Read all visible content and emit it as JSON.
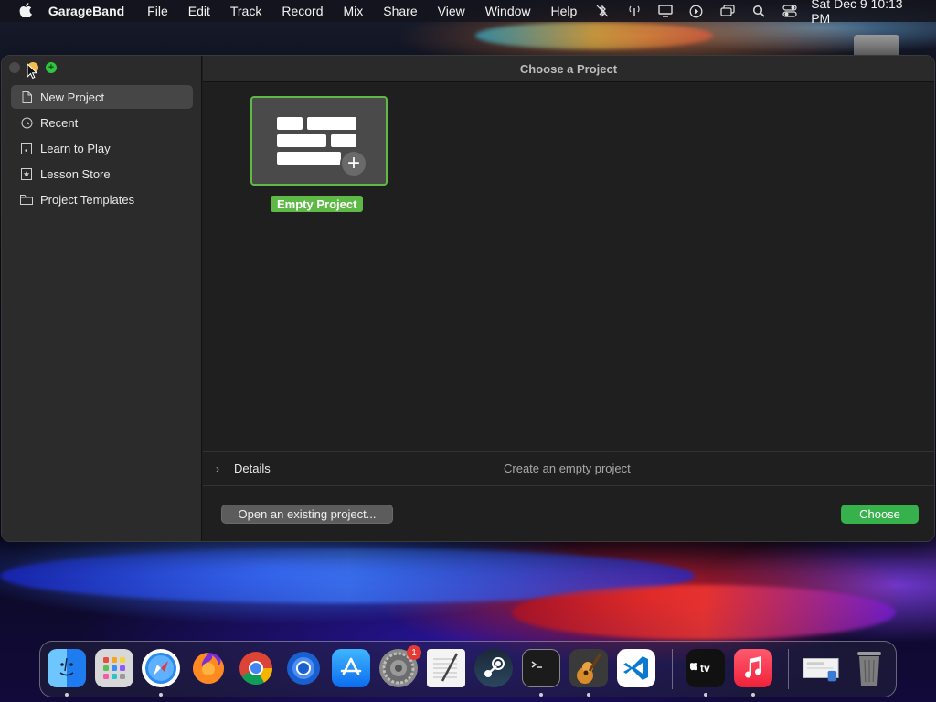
{
  "menubar": {
    "app_name": "GarageBand",
    "items": [
      "File",
      "Edit",
      "Track",
      "Record",
      "Mix",
      "Share",
      "View",
      "Window",
      "Help"
    ],
    "clock": "Sat Dec 9  10:13 PM"
  },
  "window": {
    "title": "Choose a Project",
    "sidebar": {
      "items": [
        {
          "label": "New Project",
          "icon": "document-icon",
          "selected": true
        },
        {
          "label": "Recent",
          "icon": "clock-icon",
          "selected": false
        },
        {
          "label": "Learn to Play",
          "icon": "music-book-icon",
          "selected": false
        },
        {
          "label": "Lesson Store",
          "icon": "star-icon",
          "selected": false
        },
        {
          "label": "Project Templates",
          "icon": "folder-icon",
          "selected": false
        }
      ]
    },
    "projects": [
      {
        "label": "Empty Project",
        "selected": true
      }
    ],
    "details": {
      "label": "Details",
      "description": "Create an empty project"
    },
    "buttons": {
      "open_existing": "Open an existing project...",
      "choose": "Choose"
    }
  },
  "dock": {
    "apps": [
      {
        "name": "Finder",
        "running": true
      },
      {
        "name": "Launchpad",
        "running": false
      },
      {
        "name": "Safari",
        "running": true
      },
      {
        "name": "Firefox",
        "running": false
      },
      {
        "name": "Google Chrome",
        "running": false
      },
      {
        "name": "Chromium",
        "running": false
      },
      {
        "name": "App Store",
        "running": false
      },
      {
        "name": "System Settings",
        "running": false,
        "badge": "1"
      },
      {
        "name": "TextEdit",
        "running": false
      },
      {
        "name": "Steam",
        "running": false
      },
      {
        "name": "Terminal",
        "running": true
      },
      {
        "name": "GarageBand",
        "running": true
      },
      {
        "name": "Visual Studio Code",
        "running": false
      },
      {
        "name": "Apple TV",
        "running": true
      },
      {
        "name": "Music",
        "running": true
      },
      {
        "name": "Downloads",
        "running": false
      },
      {
        "name": "Trash",
        "running": false
      }
    ]
  },
  "colors": {
    "accent_green": "#5fb946",
    "choose_button": "#37b14b",
    "sidebar_bg": "#2b2b2b",
    "main_bg": "#1f1f1f"
  }
}
